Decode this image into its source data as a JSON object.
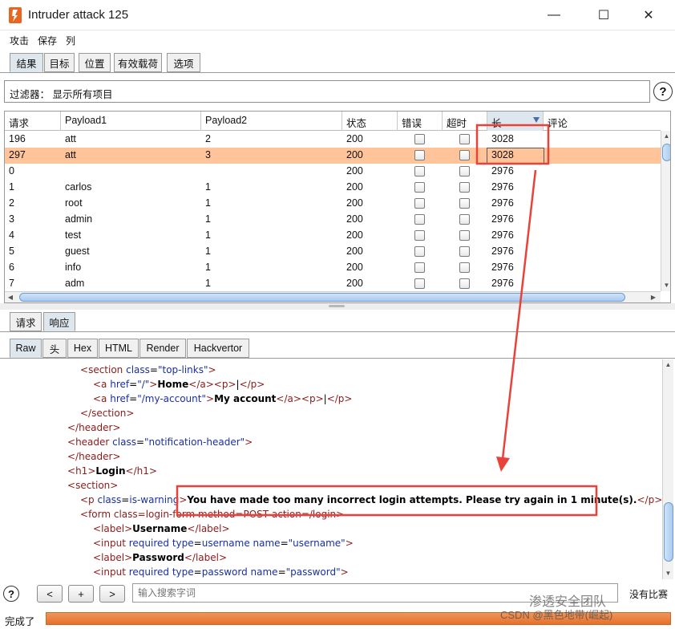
{
  "window": {
    "title": "Intruder attack 125",
    "min_glyph": "—",
    "max_glyph": "☐",
    "close_glyph": "✕"
  },
  "menu": [
    "攻击",
    "保存",
    "列"
  ],
  "main_tabs": [
    "结果",
    "目标",
    "位置",
    "有效载荷",
    "选项"
  ],
  "filter": {
    "text": "过滤器： 显示所有项目",
    "help_glyph": "?"
  },
  "table": {
    "columns": [
      "请求",
      "Payload1",
      "Payload2",
      "状态",
      "错误",
      "超时",
      "长",
      "评论"
    ],
    "rows": [
      {
        "req": "196",
        "p1": "att",
        "p2": "2",
        "status": "200",
        "len": "3028",
        "selected": false
      },
      {
        "req": "297",
        "p1": "att",
        "p2": "3",
        "status": "200",
        "len": "3028",
        "selected": true
      },
      {
        "req": "0",
        "p1": "",
        "p2": "",
        "status": "200",
        "len": "2976",
        "selected": false
      },
      {
        "req": "1",
        "p1": "carlos",
        "p2": "1",
        "status": "200",
        "len": "2976",
        "selected": false
      },
      {
        "req": "2",
        "p1": "root",
        "p2": "1",
        "status": "200",
        "len": "2976",
        "selected": false
      },
      {
        "req": "3",
        "p1": "admin",
        "p2": "1",
        "status": "200",
        "len": "2976",
        "selected": false
      },
      {
        "req": "4",
        "p1": "test",
        "p2": "1",
        "status": "200",
        "len": "2976",
        "selected": false
      },
      {
        "req": "5",
        "p1": "guest",
        "p2": "1",
        "status": "200",
        "len": "2976",
        "selected": false
      },
      {
        "req": "6",
        "p1": "info",
        "p2": "1",
        "status": "200",
        "len": "2976",
        "selected": false
      },
      {
        "req": "7",
        "p1": "adm",
        "p2": "1",
        "status": "200",
        "len": "2976",
        "selected": false
      }
    ]
  },
  "msg_tabs": [
    "请求",
    "响应"
  ],
  "view_tabs": [
    "Raw",
    "头",
    "Hex",
    "HTML",
    "Render",
    "Hackvertor"
  ],
  "code": {
    "l1": {
      "t": "section",
      "a": "class",
      "v": "\"top-links\""
    },
    "l2": {
      "href": "\"/\"",
      "text": "Home",
      "sep": "|"
    },
    "l3": {
      "href": "\"/my-account\"",
      "text": "My account",
      "sep": "|"
    },
    "l4": "section",
    "l5": "header",
    "l6": {
      "t": "header",
      "a": "class",
      "v": "\"notification-header\""
    },
    "l7": "header",
    "l8": {
      "t": "h1",
      "text": "Login"
    },
    "l9": "section",
    "l10": {
      "a": "class",
      "v": "is-warning",
      "text": "You have made too many incorrect login attempts. Please try again in 1 minute(s)."
    },
    "l11": {
      "raw": "form class=login-form method=POST action=/login"
    },
    "l12": {
      "t": "label",
      "text": "Username"
    },
    "l13": {
      "type": "username",
      "name": "\"username\""
    },
    "l14": {
      "t": "label",
      "text": "Password"
    },
    "l15": {
      "type": "password",
      "name": "\"password\""
    }
  },
  "bottom": {
    "help_glyph": "?",
    "prev": "<",
    "add": "+",
    "next": ">",
    "search_placeholder": "输入搜索字词",
    "match": "没有比赛"
  },
  "status": {
    "text": "完成了",
    "progress": 1.0
  },
  "watermark": {
    "line1": "渗透安全团队",
    "line2": "CSDN @黑色地带(崛起)"
  },
  "colors": {
    "selected_row": "#ffc49a",
    "highlight": "#e8423a",
    "progress": "#e5702a"
  }
}
